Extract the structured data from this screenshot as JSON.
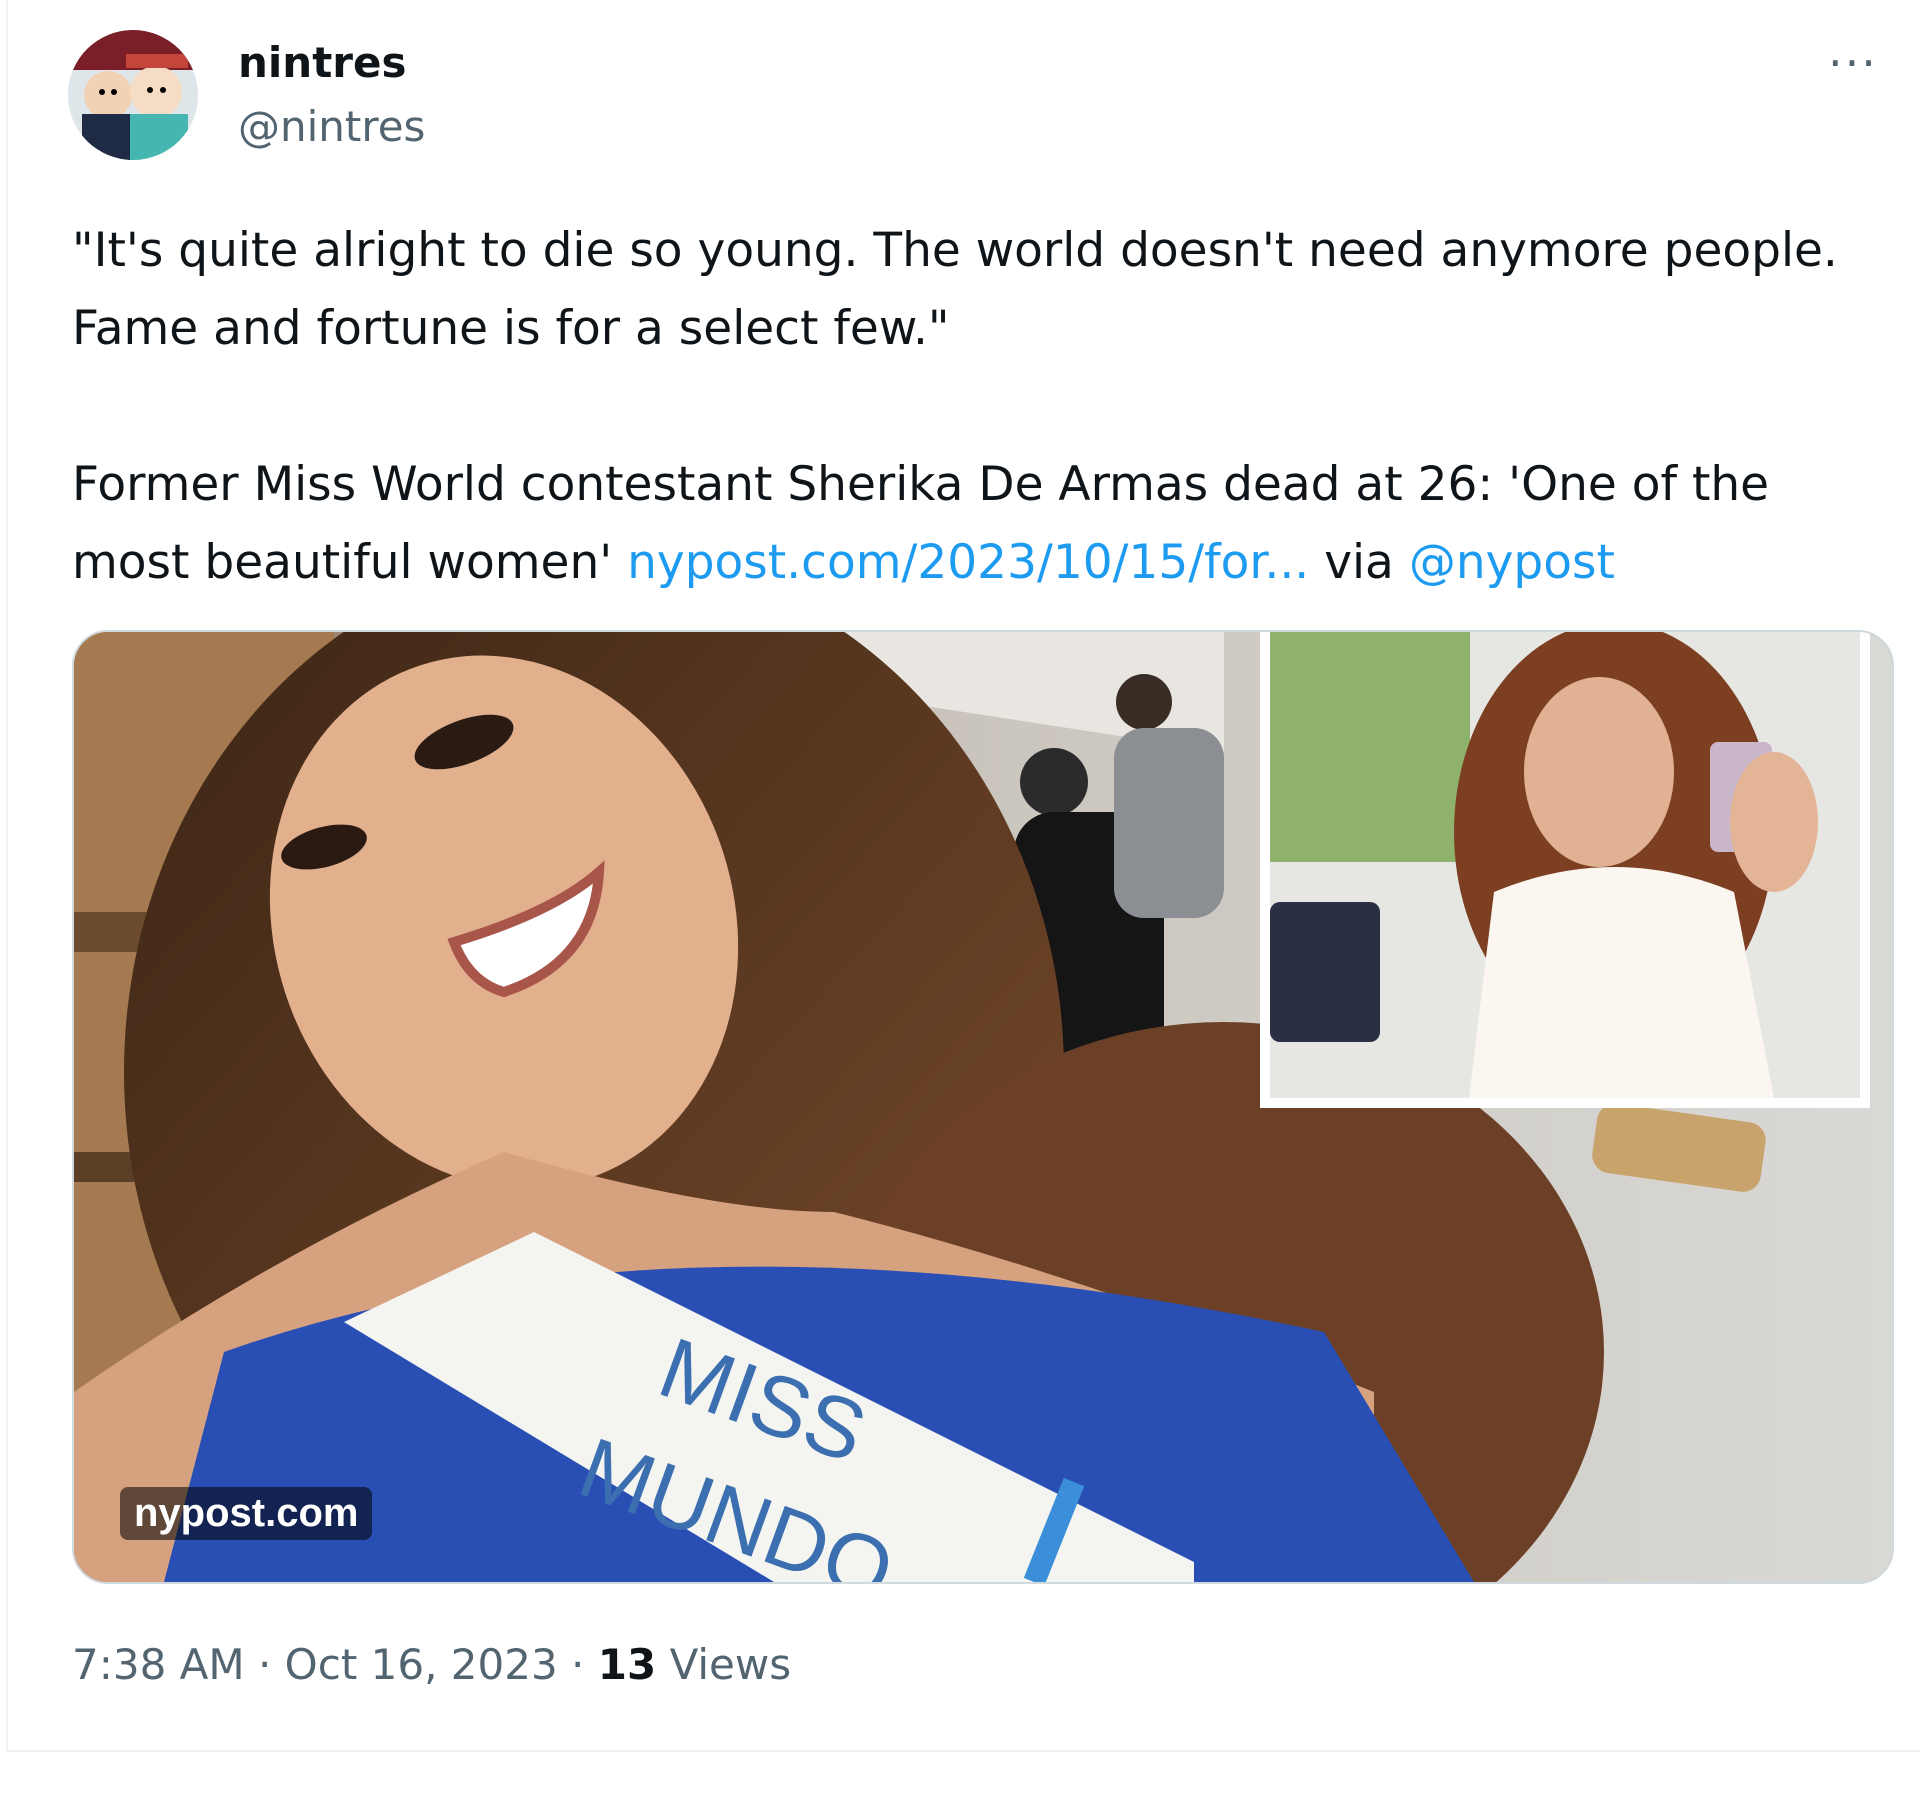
{
  "tweet": {
    "display_name": "nintres",
    "handle": "@nintres",
    "more_label": "···",
    "quote_line": "\"It's quite alright to die so young. The world doesn't need anymore people. Fame and fortune is for a select few.\"",
    "headline": "Former Miss World contestant Sherika De Armas dead at 26: 'One of the most beautiful women'",
    "link_text": "nypost.com/2023/10/15/for...",
    "via_text": "via",
    "mention": "@nypost",
    "media": {
      "watermark": "nypost.com",
      "sash_line1": "MISS",
      "sash_line2": "MUNDO"
    },
    "timestamp": "7:38 AM · Oct 16, 2023",
    "separator": "·",
    "views_count": "13",
    "views_label": "Views"
  },
  "colors": {
    "link": "#1d9bf0",
    "secondary_text": "#536471",
    "primary_text": "#0f1419"
  },
  "icons": {
    "more": "more-horizontal-icon"
  }
}
